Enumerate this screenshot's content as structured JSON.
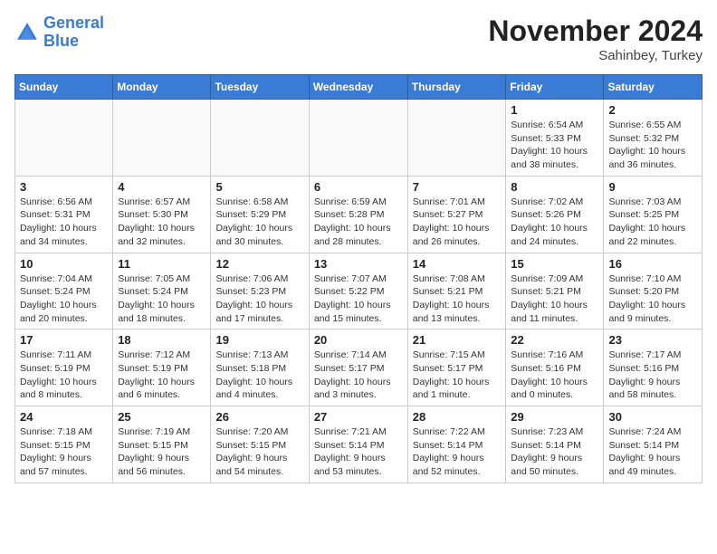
{
  "header": {
    "logo_line1": "General",
    "logo_line2": "Blue",
    "month": "November 2024",
    "location": "Sahinbey, Turkey"
  },
  "days_of_week": [
    "Sunday",
    "Monday",
    "Tuesday",
    "Wednesday",
    "Thursday",
    "Friday",
    "Saturday"
  ],
  "weeks": [
    [
      {
        "day": "",
        "info": ""
      },
      {
        "day": "",
        "info": ""
      },
      {
        "day": "",
        "info": ""
      },
      {
        "day": "",
        "info": ""
      },
      {
        "day": "",
        "info": ""
      },
      {
        "day": "1",
        "info": "Sunrise: 6:54 AM\nSunset: 5:33 PM\nDaylight: 10 hours\nand 38 minutes."
      },
      {
        "day": "2",
        "info": "Sunrise: 6:55 AM\nSunset: 5:32 PM\nDaylight: 10 hours\nand 36 minutes."
      }
    ],
    [
      {
        "day": "3",
        "info": "Sunrise: 6:56 AM\nSunset: 5:31 PM\nDaylight: 10 hours\nand 34 minutes."
      },
      {
        "day": "4",
        "info": "Sunrise: 6:57 AM\nSunset: 5:30 PM\nDaylight: 10 hours\nand 32 minutes."
      },
      {
        "day": "5",
        "info": "Sunrise: 6:58 AM\nSunset: 5:29 PM\nDaylight: 10 hours\nand 30 minutes."
      },
      {
        "day": "6",
        "info": "Sunrise: 6:59 AM\nSunset: 5:28 PM\nDaylight: 10 hours\nand 28 minutes."
      },
      {
        "day": "7",
        "info": "Sunrise: 7:01 AM\nSunset: 5:27 PM\nDaylight: 10 hours\nand 26 minutes."
      },
      {
        "day": "8",
        "info": "Sunrise: 7:02 AM\nSunset: 5:26 PM\nDaylight: 10 hours\nand 24 minutes."
      },
      {
        "day": "9",
        "info": "Sunrise: 7:03 AM\nSunset: 5:25 PM\nDaylight: 10 hours\nand 22 minutes."
      }
    ],
    [
      {
        "day": "10",
        "info": "Sunrise: 7:04 AM\nSunset: 5:24 PM\nDaylight: 10 hours\nand 20 minutes."
      },
      {
        "day": "11",
        "info": "Sunrise: 7:05 AM\nSunset: 5:24 PM\nDaylight: 10 hours\nand 18 minutes."
      },
      {
        "day": "12",
        "info": "Sunrise: 7:06 AM\nSunset: 5:23 PM\nDaylight: 10 hours\nand 17 minutes."
      },
      {
        "day": "13",
        "info": "Sunrise: 7:07 AM\nSunset: 5:22 PM\nDaylight: 10 hours\nand 15 minutes."
      },
      {
        "day": "14",
        "info": "Sunrise: 7:08 AM\nSunset: 5:21 PM\nDaylight: 10 hours\nand 13 minutes."
      },
      {
        "day": "15",
        "info": "Sunrise: 7:09 AM\nSunset: 5:21 PM\nDaylight: 10 hours\nand 11 minutes."
      },
      {
        "day": "16",
        "info": "Sunrise: 7:10 AM\nSunset: 5:20 PM\nDaylight: 10 hours\nand 9 minutes."
      }
    ],
    [
      {
        "day": "17",
        "info": "Sunrise: 7:11 AM\nSunset: 5:19 PM\nDaylight: 10 hours\nand 8 minutes."
      },
      {
        "day": "18",
        "info": "Sunrise: 7:12 AM\nSunset: 5:19 PM\nDaylight: 10 hours\nand 6 minutes."
      },
      {
        "day": "19",
        "info": "Sunrise: 7:13 AM\nSunset: 5:18 PM\nDaylight: 10 hours\nand 4 minutes."
      },
      {
        "day": "20",
        "info": "Sunrise: 7:14 AM\nSunset: 5:17 PM\nDaylight: 10 hours\nand 3 minutes."
      },
      {
        "day": "21",
        "info": "Sunrise: 7:15 AM\nSunset: 5:17 PM\nDaylight: 10 hours\nand 1 minute."
      },
      {
        "day": "22",
        "info": "Sunrise: 7:16 AM\nSunset: 5:16 PM\nDaylight: 10 hours\nand 0 minutes."
      },
      {
        "day": "23",
        "info": "Sunrise: 7:17 AM\nSunset: 5:16 PM\nDaylight: 9 hours\nand 58 minutes."
      }
    ],
    [
      {
        "day": "24",
        "info": "Sunrise: 7:18 AM\nSunset: 5:15 PM\nDaylight: 9 hours\nand 57 minutes."
      },
      {
        "day": "25",
        "info": "Sunrise: 7:19 AM\nSunset: 5:15 PM\nDaylight: 9 hours\nand 56 minutes."
      },
      {
        "day": "26",
        "info": "Sunrise: 7:20 AM\nSunset: 5:15 PM\nDaylight: 9 hours\nand 54 minutes."
      },
      {
        "day": "27",
        "info": "Sunrise: 7:21 AM\nSunset: 5:14 PM\nDaylight: 9 hours\nand 53 minutes."
      },
      {
        "day": "28",
        "info": "Sunrise: 7:22 AM\nSunset: 5:14 PM\nDaylight: 9 hours\nand 52 minutes."
      },
      {
        "day": "29",
        "info": "Sunrise: 7:23 AM\nSunset: 5:14 PM\nDaylight: 9 hours\nand 50 minutes."
      },
      {
        "day": "30",
        "info": "Sunrise: 7:24 AM\nSunset: 5:14 PM\nDaylight: 9 hours\nand 49 minutes."
      }
    ]
  ]
}
